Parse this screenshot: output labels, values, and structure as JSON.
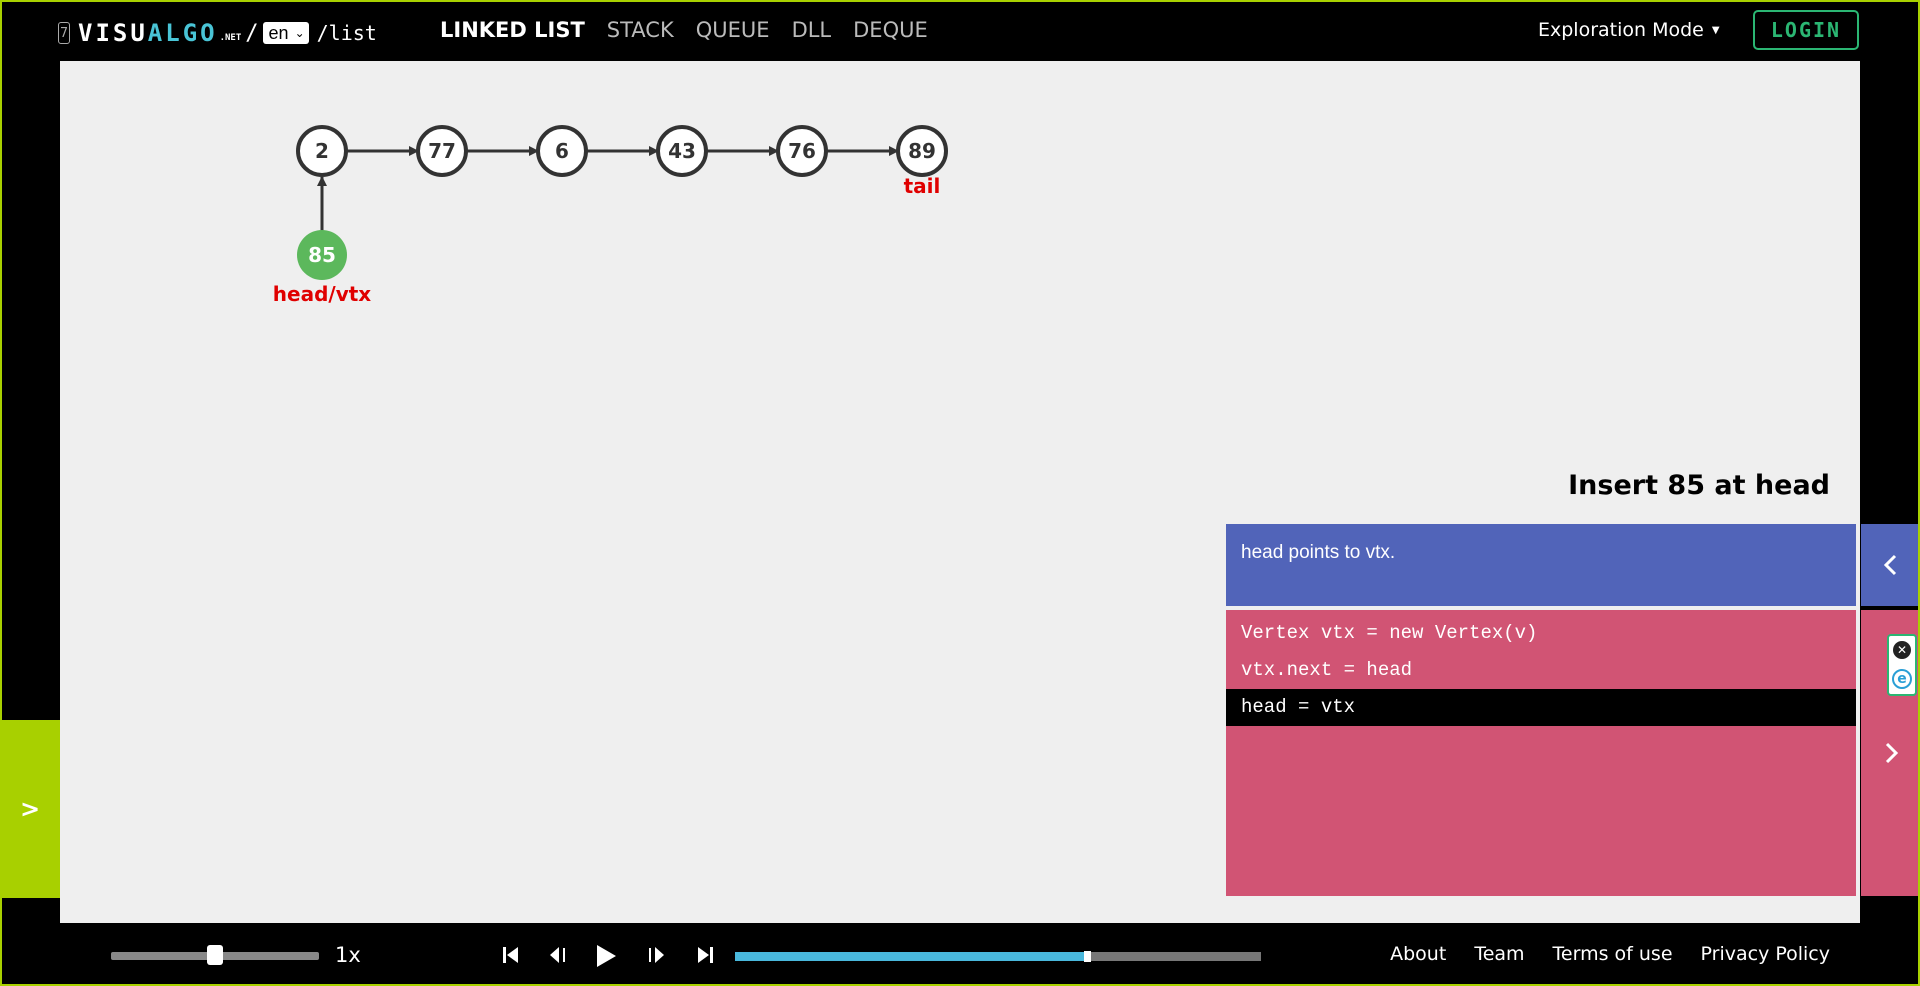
{
  "topbar": {
    "logo_icon": "7",
    "logo_visu": "VISU",
    "logo_algo": "ALGO",
    "logo_net": ".NET",
    "slash": "/",
    "language": "en",
    "path": "/list",
    "nav": [
      {
        "label": "LINKED LIST",
        "active": true
      },
      {
        "label": "STACK",
        "active": false
      },
      {
        "label": "QUEUE",
        "active": false
      },
      {
        "label": "DLL",
        "active": false
      },
      {
        "label": "DEQUE",
        "active": false
      }
    ],
    "mode": "Exploration Mode",
    "login": "LOGIN"
  },
  "visualization": {
    "nodes": [
      "2",
      "77",
      "6",
      "43",
      "76",
      "89"
    ],
    "tail_label": "tail",
    "new_node": "85",
    "new_node_label": "head/vtx",
    "colors": {
      "new_node": "#5cb85c",
      "label": "#e00000",
      "node_stroke": "#333333"
    }
  },
  "sidebar_toggle": ">",
  "status": {
    "title": "Insert 85 at head",
    "message": "head points to vtx."
  },
  "code": {
    "lines": [
      "Vertex vtx = new Vertex(v)",
      "vtx.next = head",
      "head = vtx"
    ],
    "highlighted_index": 2
  },
  "controls": {
    "speed_label": "1x",
    "speed_value": 0.5,
    "progress_value": 0.67
  },
  "footer": {
    "links": [
      "About",
      "Team",
      "Terms of use",
      "Privacy Policy"
    ]
  },
  "icons": [
    "chevron-left-icon",
    "chevron-right-icon",
    "skip-start-icon",
    "step-back-icon",
    "play-icon",
    "step-forward-icon",
    "skip-end-icon",
    "close-icon",
    "e-extension-icon"
  ]
}
